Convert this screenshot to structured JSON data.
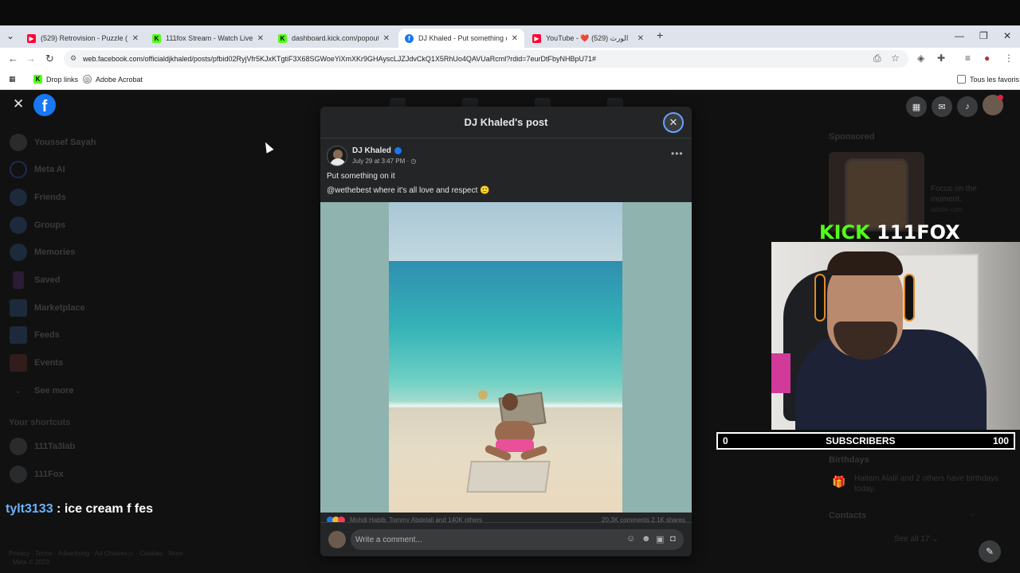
{
  "browser": {
    "tabs": [
      {
        "label": "(529) Retrovision - Puzzle (202",
        "color": "#ff0033",
        "glyph": "▶"
      },
      {
        "label": "111fox Stream - Watch Live on",
        "color": "#53fc18",
        "glyph": "K"
      },
      {
        "label": "dashboard.kick.com/popout/1",
        "color": "#53fc18",
        "glyph": "K"
      },
      {
        "label": "DJ Khaled - Put something on i",
        "color": "#1877f2",
        "glyph": "f"
      },
      {
        "label": "YouTube - ❤️ الورث (529)",
        "color": "#ff0033",
        "glyph": "▶"
      }
    ],
    "new_tab": "+",
    "url": "web.facebook.com/officialdjkhaled/posts/pfbid02RyjVfr5KJxKTgtiF3X68SGWoeYiXmXKr9GHAyscLJZJdvCkQ1X5RhUo4QAVUaRcml?rdid=7eurDtFbyNHBpU71#",
    "bookmarks": {
      "drop_links": "Drop links",
      "acrobat": "Adobe Acrobat",
      "all_favorites": "Tous les favoris"
    }
  },
  "facebook": {
    "sidebar": [
      {
        "label": "Youssef Sayah"
      },
      {
        "label": "Meta AI"
      },
      {
        "label": "Friends"
      },
      {
        "label": "Groups"
      },
      {
        "label": "Memories"
      },
      {
        "label": "Saved"
      },
      {
        "label": "Marketplace"
      },
      {
        "label": "Feeds"
      },
      {
        "label": "Events"
      },
      {
        "label": "See more"
      }
    ],
    "shortcuts_heading": "Your shortcuts",
    "shortcuts": [
      {
        "label": "111Ta3lab"
      },
      {
        "label": "111Fox"
      }
    ],
    "footer": "Privacy · Terms · Advertising · Ad Choices ▷ · Cookies · More · Meta © 2023",
    "right": {
      "sponsored": "Sponsored",
      "ad_text": "Focus on the moment.",
      "ad_domain": "adobe.com",
      "birthdays": "Birthdays",
      "birthday_text": "Haitam Alalil and 2 others have birthdays today.",
      "contacts": "Contacts",
      "see_all": "See all 17 ⌄"
    }
  },
  "modal": {
    "title": "DJ Khaled's post",
    "author": "DJ Khaled",
    "time": "July 29 at 3:47 PM · ◷",
    "text1": "Put something on it",
    "text2": "@wethebest where it's all love and respect 🙂",
    "reactions": "Mohdi Habib, Tommy Abdelali and 140K others",
    "stats": "20.3K comments  2.1K shares",
    "comment_placeholder": "Write a comment..."
  },
  "stream_overlay": {
    "kick": "KICK",
    "channel": "111FOX",
    "sub_current": "0",
    "sub_label": "SUBSCRIBERS",
    "sub_goal": "100",
    "chat_user": "tylt3133",
    "chat_msg": " : ice cream f fes"
  }
}
